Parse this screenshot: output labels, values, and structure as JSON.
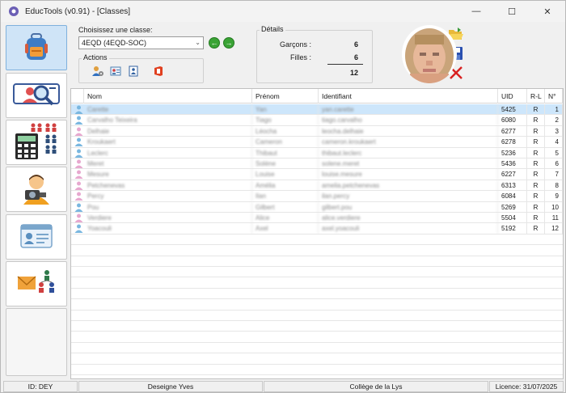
{
  "window": {
    "title": "EducTools (v0.91) - [Classes]",
    "minimize_glyph": "—",
    "maximize_glyph": "☐",
    "close_glyph": "✕"
  },
  "sidebar": {
    "items": [
      {
        "name": "classes",
        "icon": "backpack-icon",
        "active": true
      },
      {
        "name": "search-students",
        "icon": "magnifier-person-icon",
        "active": false
      },
      {
        "name": "calculator-groups",
        "icon": "calculator-people-icon",
        "active": false
      },
      {
        "name": "webcam-photo",
        "icon": "person-camera-icon",
        "active": false
      },
      {
        "name": "id-cards",
        "icon": "id-card-icon",
        "active": false
      },
      {
        "name": "mailing",
        "icon": "envelope-people-icon",
        "active": false
      }
    ]
  },
  "class_select": {
    "label": "Choisissez une classe:",
    "value": "4EQD (4EQD-SOC)"
  },
  "actions": {
    "title": "Actions",
    "icons": [
      "user-settings-icon",
      "id-card-edit-icon",
      "export-users-icon",
      "office-icon"
    ]
  },
  "details": {
    "title": "Détails",
    "boys_label": "Garçons :",
    "boys_value": "6",
    "girls_label": "Filles :",
    "girls_value": "6",
    "total_value": "12"
  },
  "toolbar": {
    "open_icon": "folder-open-icon",
    "save_icon": "save-icon",
    "delete_icon": "delete-x-icon"
  },
  "table": {
    "headers": {
      "nom": "Nom",
      "prenom": "Prénom",
      "identifiant": "Identifiant",
      "uid": "UID",
      "rl": "R-L",
      "no": "N°"
    },
    "rows": [
      {
        "gender": "m",
        "nom": "Carette",
        "prenom": "Yan",
        "identifiant": "yan.carette",
        "uid": "5425",
        "rl": "R",
        "no": "1"
      },
      {
        "gender": "m",
        "nom": "Carvalho Teixeira",
        "prenom": "Tiago",
        "identifiant": "tiago.carvalho",
        "uid": "6080",
        "rl": "R",
        "no": "2"
      },
      {
        "gender": "f",
        "nom": "Delhaie",
        "prenom": "Léocha",
        "identifiant": "leocha.delhaie",
        "uid": "6277",
        "rl": "R",
        "no": "3"
      },
      {
        "gender": "m",
        "nom": "Kroukaert",
        "prenom": "Cameron",
        "identifiant": "cameron.kroukaert",
        "uid": "6278",
        "rl": "R",
        "no": "4"
      },
      {
        "gender": "m",
        "nom": "Leclerc",
        "prenom": "Thibaut",
        "identifiant": "thibaut.leclerc",
        "uid": "5236",
        "rl": "R",
        "no": "5"
      },
      {
        "gender": "f",
        "nom": "Meret",
        "prenom": "Solène",
        "identifiant": "solene.meret",
        "uid": "5436",
        "rl": "R",
        "no": "6"
      },
      {
        "gender": "f",
        "nom": "Mesure",
        "prenom": "Louise",
        "identifiant": "louise.mesure",
        "uid": "6227",
        "rl": "R",
        "no": "7"
      },
      {
        "gender": "f",
        "nom": "Petchenevas",
        "prenom": "Amélia",
        "identifiant": "amelia.petchenevas",
        "uid": "6313",
        "rl": "R",
        "no": "8"
      },
      {
        "gender": "f",
        "nom": "Percy",
        "prenom": "Ilan",
        "identifiant": "ilan.percy",
        "uid": "6084",
        "rl": "R",
        "no": "9"
      },
      {
        "gender": "m",
        "nom": "Pou",
        "prenom": "Gilbert",
        "identifiant": "gilbert.pou",
        "uid": "5269",
        "rl": "R",
        "no": "10"
      },
      {
        "gender": "f",
        "nom": "Verdiere",
        "prenom": "Alice",
        "identifiant": "alice.verdiere",
        "uid": "5504",
        "rl": "R",
        "no": "11"
      },
      {
        "gender": "m",
        "nom": "Yoacouli",
        "prenom": "Axel",
        "identifiant": "axel.yoacouli",
        "uid": "5192",
        "rl": "R",
        "no": "12"
      }
    ]
  },
  "status_bar": {
    "id": "ID: DEY",
    "teacher": "Deseigne Yves",
    "school": "Collège de la Lys",
    "licence": "Licence: 31/07/2025"
  },
  "colors": {
    "selected_row": "#cde6fb",
    "active_sidebar": "#cfe4f7",
    "nav_green": "#3aa335",
    "boy_icon": "#7ab7e0",
    "girl_icon": "#e7a8cf"
  }
}
